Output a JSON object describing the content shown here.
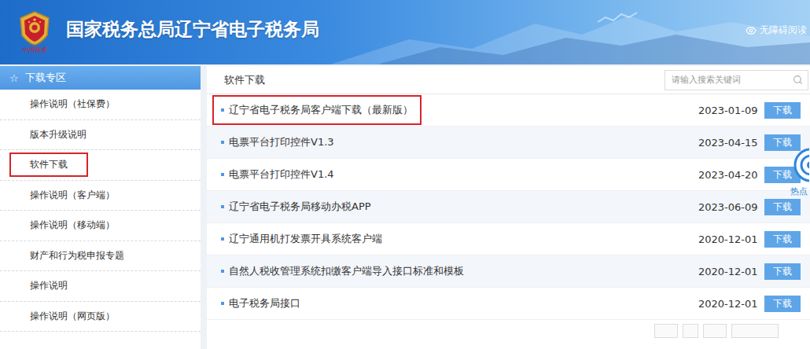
{
  "header": {
    "title": "国家税务总局辽宁省电子税务局",
    "emblem_caption": "中国税务",
    "accessibility": "无障碍阅读"
  },
  "sidebar": {
    "icon": "☆",
    "title": "下载专区",
    "items": [
      {
        "label": "操作说明（社保费）",
        "highlighted": false
      },
      {
        "label": "版本升级说明",
        "highlighted": false
      },
      {
        "label": "软件下载",
        "highlighted": true
      },
      {
        "label": "操作说明（客户端）",
        "highlighted": false
      },
      {
        "label": "操作说明（移动端）",
        "highlighted": false
      },
      {
        "label": "财产和行为税申报专题",
        "highlighted": false
      },
      {
        "label": "操作说明",
        "highlighted": false
      },
      {
        "label": "操作说明（网页版）",
        "highlighted": false
      }
    ]
  },
  "content": {
    "title": "软件下载",
    "search": {
      "placeholder": "请输入搜索关键词"
    },
    "rows": [
      {
        "title": "辽宁省电子税务局客户端下载（最新版）",
        "date": "2023-01-09",
        "action": "下载",
        "highlighted": true
      },
      {
        "title": "电票平台打印控件V1.3",
        "date": "2023-04-15",
        "action": "下载",
        "highlighted": false
      },
      {
        "title": "电票平台打印控件V1.4",
        "date": "2023-04-20",
        "action": "下载",
        "highlighted": false
      },
      {
        "title": "辽宁省电子税务局移动办税APP",
        "date": "2023-06-09",
        "action": "下载",
        "highlighted": false
      },
      {
        "title": "辽宁通用机打发票开具系统客户端",
        "date": "2020-12-01",
        "action": "下载",
        "highlighted": false
      },
      {
        "title": "自然人税收管理系统扣缴客户端导入接口标准和模板",
        "date": "2020-12-01",
        "action": "下载",
        "highlighted": false
      },
      {
        "title": "电子税务局接口",
        "date": "2020-12-01",
        "action": "下载",
        "highlighted": false
      }
    ]
  },
  "float_widget": {
    "label": "热点"
  }
}
